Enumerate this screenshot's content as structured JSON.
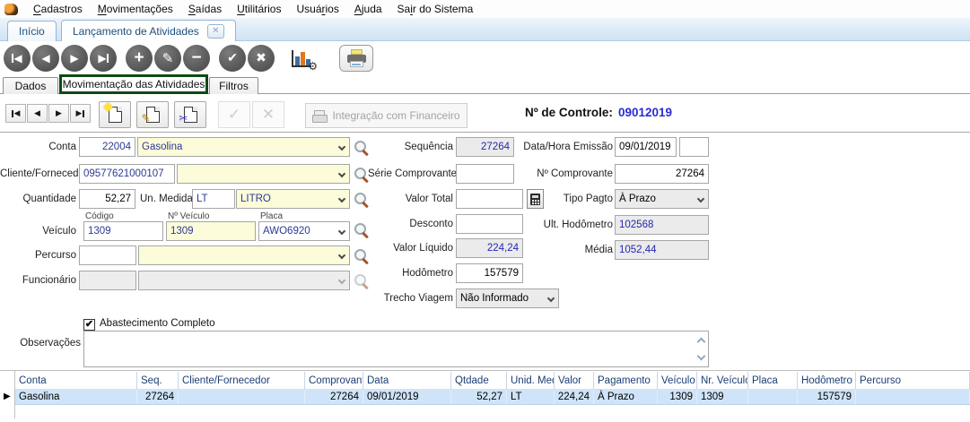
{
  "colors": {
    "field_yellow": "#fcfbda",
    "lookup_navy": "#2b3a94",
    "readonly_value_blue": "#2626b0",
    "control_number_blue": "#2b2bd0",
    "active_subtab_border_green": "#0e4a14",
    "grid_header_text": "#1b3e75",
    "grid_row_highlight": "#cfe4f8",
    "tab_text": "#1d4f7c"
  },
  "menu": {
    "app_icon": "app-logo-icon",
    "items": [
      {
        "label": "Cadastros",
        "accel_index": 0
      },
      {
        "label": "Movimentações",
        "accel_index": 0
      },
      {
        "label": "Saídas",
        "accel_index": 0
      },
      {
        "label": "Utilitários",
        "accel_index": 0
      },
      {
        "label": "Usuários",
        "accel_index": 4
      },
      {
        "label": "Ajuda",
        "accel_index": 0
      },
      {
        "label": "Sair do Sistema",
        "accel_index": 2
      }
    ]
  },
  "window_tabs": [
    {
      "label": "Início"
    },
    {
      "label": "Lançamento de Atividades",
      "close_glyph": "✕"
    }
  ],
  "toolbar": {
    "glyphs": {
      "prev": "◀",
      "next": "▶",
      "add": "+",
      "edit": "✎",
      "remove": "−",
      "confirm": "✔",
      "cancel": "✖",
      "gear": "⚙"
    },
    "icons": [
      "first-record",
      "previous-record",
      "next-record",
      "last-record",
      "add-record",
      "edit-record",
      "delete-record",
      "confirm",
      "cancel",
      "chart-settings",
      "print"
    ]
  },
  "subtabs": [
    {
      "label": "Dados"
    },
    {
      "label": "Movimentação das Atividades"
    },
    {
      "label": "Filtros"
    }
  ],
  "record_bar": {
    "nav_glyphs": {
      "prev": "◀",
      "next": "▶"
    },
    "doc_glyphs": {
      "delete": "✂",
      "edit": "✎"
    },
    "confirm_glyph": "✓",
    "cancel_glyph": "✕",
    "integration_label": "Integração com Financeiro",
    "control_label": "Nº de Controle:",
    "control_value": "09012019"
  },
  "form": {
    "conta": {
      "label": "Conta",
      "code": "22004",
      "desc": "Gasolina"
    },
    "cliente": {
      "label": "Cliente/Fornecedor",
      "code": "09577621000107",
      "desc": ""
    },
    "quantidade": {
      "label": "Quantidade",
      "value": "52,27"
    },
    "un_medida": {
      "label": "Un. Medida",
      "code": "LT",
      "desc": "LITRO"
    },
    "veiculo": {
      "label": "Veículo",
      "col_codigo": "Código",
      "col_nr": "Nº Veículo",
      "col_placa": "Placa",
      "codigo": "1309",
      "nr": "1309",
      "placa": "AWO6920"
    },
    "percurso": {
      "label": "Percurso",
      "code": "",
      "desc": ""
    },
    "funcionario": {
      "label": "Funcionário",
      "code": "",
      "desc": ""
    },
    "sequencia": {
      "label": "Sequência",
      "value": "27264"
    },
    "serie_comprovante": {
      "label": "Série Comprovante",
      "value": ""
    },
    "valor_total": {
      "label": "Valor Total",
      "value": ""
    },
    "desconto": {
      "label": "Desconto",
      "value": ""
    },
    "valor_liquido": {
      "label": "Valor Líquido",
      "value": "224,24"
    },
    "hodometro": {
      "label": "Hodômetro",
      "value": "157579"
    },
    "trecho_viagem": {
      "label": "Trecho Viagem",
      "value": "Não Informado"
    },
    "data_emissao": {
      "label": "Data/Hora Emissão",
      "date": "09/01/2019",
      "time": ""
    },
    "n_comprovante": {
      "label": "Nº Comprovante",
      "value": "27264"
    },
    "tipo_pagto": {
      "label": "Tipo Pagto",
      "value": "À Prazo"
    },
    "ult_hodometro": {
      "label": "Ult. Hodômetro",
      "value": "102568"
    },
    "media": {
      "label": "Média",
      "value": "1052,44"
    },
    "abastecimento": {
      "label": "Abastecimento Completo",
      "checked": "✔"
    },
    "observacoes": {
      "label": "Observações",
      "value": ""
    }
  },
  "grid": {
    "columns": [
      "Conta",
      "Seq.",
      "Cliente/Fornecedor",
      "Comprovante",
      "Data",
      "Qtdade",
      "Unid. Med.",
      "Valor",
      "Pagamento",
      "Veículo",
      "Nr. Veículo",
      "Placa",
      "Hodômetro",
      "Percurso"
    ],
    "rows": [
      [
        "Gasolina",
        "27264",
        "",
        "27264",
        "09/01/2019",
        "52,27",
        "LT",
        "224,24",
        "À Prazo",
        "1309",
        "1309",
        "",
        "157579",
        ""
      ]
    ]
  }
}
